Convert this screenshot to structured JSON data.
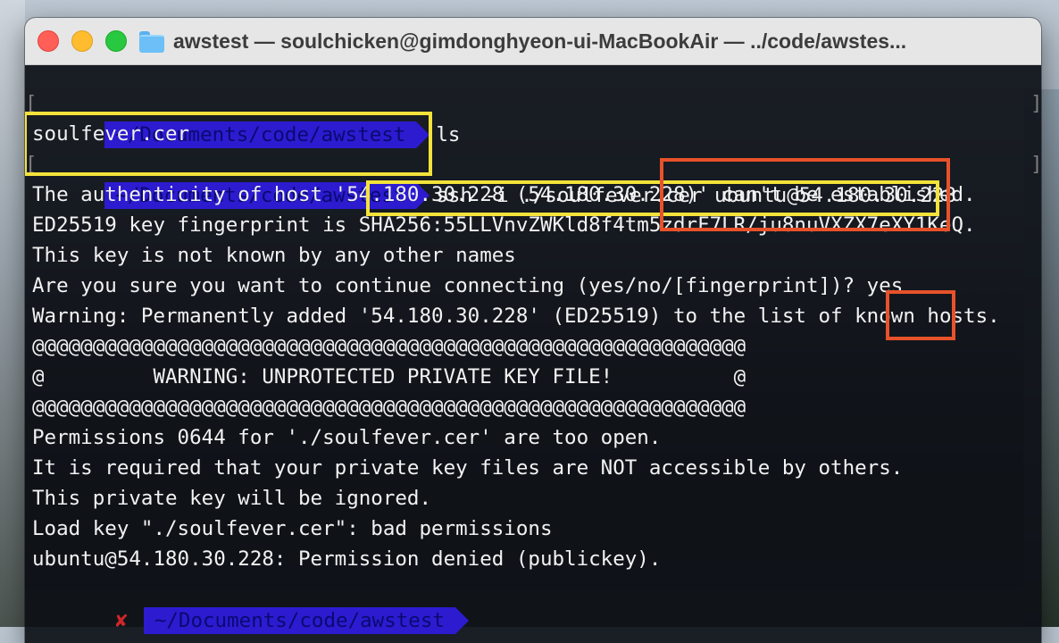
{
  "window": {
    "title": "awstest — soulchicken@gimdonghyeon-ui-MacBookAir — ../code/awstes..."
  },
  "terminal": {
    "bracket_open": "[",
    "bracket_close": "]",
    "prompt1": {
      "path": "~/Documents/code/awstest",
      "command": "ls"
    },
    "ls_output": "soulfever.cer",
    "prompt2": {
      "path": "~/Documents/code/awstest",
      "command": "ssh -i ./soulfever.cer ubuntu@54.180.30.228"
    },
    "output_lines": [
      "The authenticity of host '54.180.30.228 (54.180.30.228)' can't be established.",
      "ED25519 key fingerprint is SHA256:55LLVnvZWKld8f4tm5zdrF7LR/ju8nuVXZX7eXY1KeQ.",
      "This key is not known by any other names",
      "Are you sure you want to continue connecting (yes/no/[fingerprint])? yes",
      "Warning: Permanently added '54.180.30.228' (ED25519) to the list of known hosts.",
      "@@@@@@@@@@@@@@@@@@@@@@@@@@@@@@@@@@@@@@@@@@@@@@@@@@@@@@@@@@@",
      "@         WARNING: UNPROTECTED PRIVATE KEY FILE!          @",
      "@@@@@@@@@@@@@@@@@@@@@@@@@@@@@@@@@@@@@@@@@@@@@@@@@@@@@@@@@@@",
      "Permissions 0644 for './soulfever.cer' are too open.",
      "It is required that your private key files are NOT accessible by others.",
      "This private key will be ignored.",
      "Load key \"./soulfever.cer\": bad permissions",
      "ubuntu@54.180.30.228: Permission denied (publickey)."
    ],
    "prompt3": {
      "status_icon": "✘",
      "path": "~/Documents/code/awstest"
    }
  },
  "colors": {
    "prompt_segment": "#2d1bd0",
    "highlight_yellow": "#f3e23a",
    "highlight_red": "#e8522a",
    "error_x": "#d0262a"
  }
}
